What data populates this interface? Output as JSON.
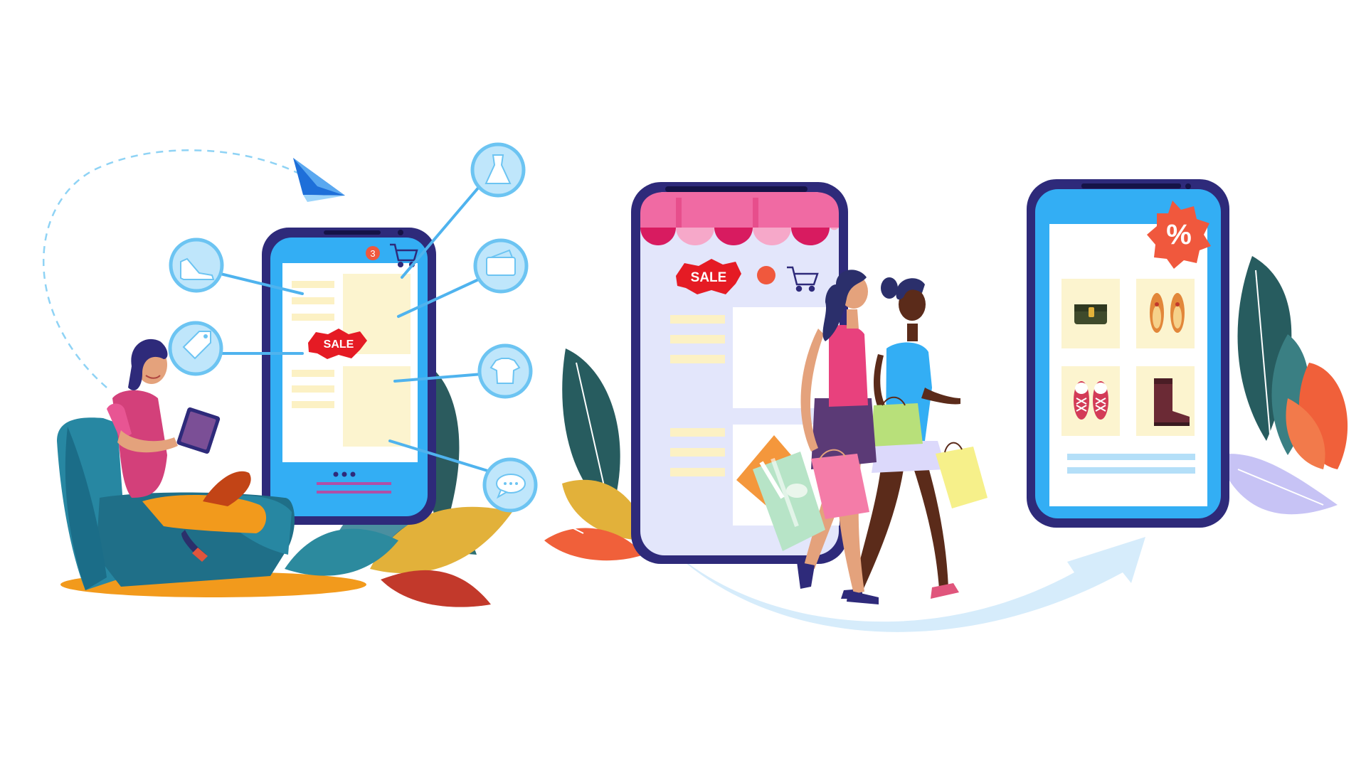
{
  "illustration": {
    "left_phone": {
      "cart_badge_count": "3",
      "sale_label": "SALE"
    },
    "middle_phone": {
      "sale_label": "SALE"
    },
    "right_phone": {
      "discount_symbol": "%"
    },
    "category_icons": [
      "shoe-icon",
      "price-tag-icon",
      "dress-icon",
      "wallet-icon",
      "tshirt-icon",
      "chat-bubble-icon"
    ],
    "colors": {
      "phone_frame": "#2e2a7a",
      "phone_screen": "#33aef4",
      "sale_badge": "#e51b24",
      "awning_pink": "#f06aa3",
      "awning_magenta": "#d81b60",
      "arrow_light_blue": "#d6ecfb",
      "circle_icon_border": "#6cc4f2"
    }
  }
}
